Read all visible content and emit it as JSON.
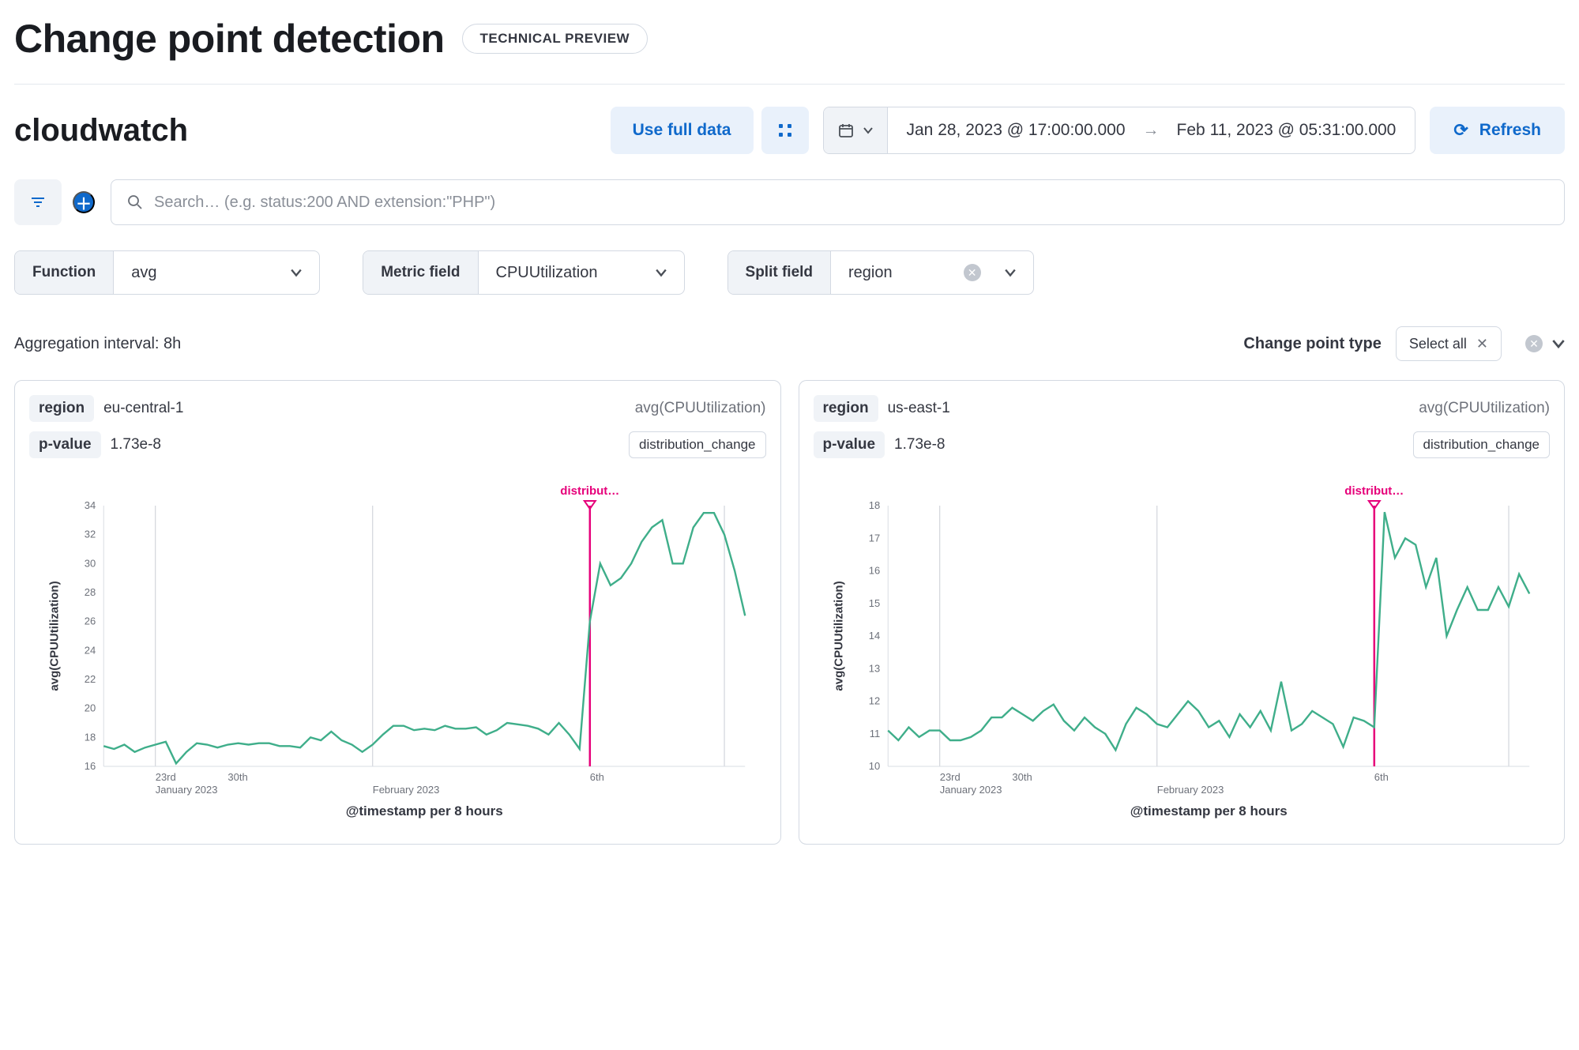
{
  "page": {
    "title": "Change point detection",
    "badge": "TECHNICAL PREVIEW"
  },
  "index": {
    "name": "cloudwatch"
  },
  "toolbar": {
    "use_full_data": "Use full data",
    "refresh": "Refresh",
    "date_from": "Jan 28, 2023 @ 17:00:00.000",
    "date_to": "Feb 11, 2023 @ 05:31:00.000"
  },
  "search": {
    "placeholder": "Search… (e.g. status:200 AND extension:\"PHP\")",
    "value": ""
  },
  "controls": {
    "function_label": "Function",
    "function_value": "avg",
    "metric_label": "Metric field",
    "metric_value": "CPUUtilization",
    "split_label": "Split field",
    "split_value": "region"
  },
  "subrow": {
    "agg_interval": "Aggregation interval: 8h",
    "cp_type_label": "Change point type",
    "select_all_label": "Select all"
  },
  "cards": [
    {
      "region_tag": "region",
      "region_value": "eu-central-1",
      "metric_label": "avg(CPUUtilization)",
      "pvalue_tag": "p-value",
      "pvalue_value": "1.73e-8",
      "type_badge": "distribution_change",
      "chart": 0
    },
    {
      "region_tag": "region",
      "region_value": "us-east-1",
      "metric_label": "avg(CPUUtilization)",
      "pvalue_tag": "p-value",
      "pvalue_value": "1.73e-8",
      "type_badge": "distribution_change",
      "chart": 1
    }
  ],
  "chart_meta": {
    "annotation_label": "distribut…",
    "ylabel": "avg(CPUUtilization)",
    "xlabel": "@timestamp per 8 hours",
    "x_month_ticks": [
      "23rd",
      "30th",
      "6th"
    ],
    "x_month_sublabels": [
      "January 2023",
      "February 2023"
    ]
  },
  "chart_data": [
    {
      "type": "line",
      "title": "avg(CPUUtilization) — region eu-central-1",
      "ylabel": "avg(CPUUtilization)",
      "xlabel": "@timestamp per 8 hours",
      "ylim": [
        16,
        34
      ],
      "y_ticks": [
        16,
        18,
        20,
        22,
        24,
        26,
        28,
        30,
        32,
        34
      ],
      "x_range": [
        "2023-01-21",
        "2023-02-12"
      ],
      "annotation": {
        "label": "distribution_change",
        "x_index": 47
      },
      "vertical_guides_x_index": [
        5,
        26,
        47,
        60
      ],
      "series": [
        {
          "name": "avg(CPUUtilization)",
          "color": "#3fae8a",
          "values": [
            17.4,
            17.2,
            17.5,
            17.0,
            17.3,
            17.5,
            17.7,
            16.2,
            17.0,
            17.6,
            17.5,
            17.3,
            17.5,
            17.6,
            17.5,
            17.6,
            17.6,
            17.4,
            17.4,
            17.3,
            18.0,
            17.8,
            18.4,
            17.8,
            17.5,
            17.0,
            17.5,
            18.2,
            18.8,
            18.8,
            18.5,
            18.6,
            18.5,
            18.8,
            18.6,
            18.6,
            18.7,
            18.2,
            18.5,
            19.0,
            18.9,
            18.8,
            18.6,
            18.2,
            19.0,
            18.2,
            17.2,
            26.0,
            30.0,
            28.5,
            29.0,
            30.0,
            31.5,
            32.5,
            33.0,
            30.0,
            30.0,
            32.5,
            33.5,
            33.5,
            32.0,
            29.5,
            26.4
          ]
        }
      ],
      "x_labels_sample": [
        "23rd",
        "30th",
        "6th"
      ]
    },
    {
      "type": "line",
      "title": "avg(CPUUtilization) — region us-east-1",
      "ylabel": "avg(CPUUtilization)",
      "xlabel": "@timestamp per 8 hours",
      "ylim": [
        10,
        18
      ],
      "y_ticks": [
        10,
        11,
        12,
        13,
        14,
        15,
        16,
        17,
        18
      ],
      "x_range": [
        "2023-01-21",
        "2023-02-12"
      ],
      "annotation": {
        "label": "distribution_change",
        "x_index": 47
      },
      "vertical_guides_x_index": [
        5,
        26,
        47,
        60
      ],
      "series": [
        {
          "name": "avg(CPUUtilization)",
          "color": "#3fae8a",
          "values": [
            11.1,
            10.8,
            11.2,
            10.9,
            11.1,
            11.1,
            10.8,
            10.8,
            10.9,
            11.1,
            11.5,
            11.5,
            11.8,
            11.6,
            11.4,
            11.7,
            11.9,
            11.4,
            11.1,
            11.5,
            11.2,
            11.0,
            10.5,
            11.3,
            11.8,
            11.6,
            11.3,
            11.2,
            11.6,
            12.0,
            11.7,
            11.2,
            11.4,
            10.9,
            11.6,
            11.2,
            11.7,
            11.1,
            12.6,
            11.1,
            11.3,
            11.7,
            11.5,
            11.3,
            10.6,
            11.5,
            11.4,
            11.2,
            17.8,
            16.4,
            17.0,
            16.8,
            15.5,
            16.4,
            14.0,
            14.8,
            15.5,
            14.8,
            14.8,
            15.5,
            14.9,
            15.9,
            15.3
          ]
        }
      ],
      "x_labels_sample": [
        "23rd",
        "30th",
        "6th"
      ]
    }
  ]
}
